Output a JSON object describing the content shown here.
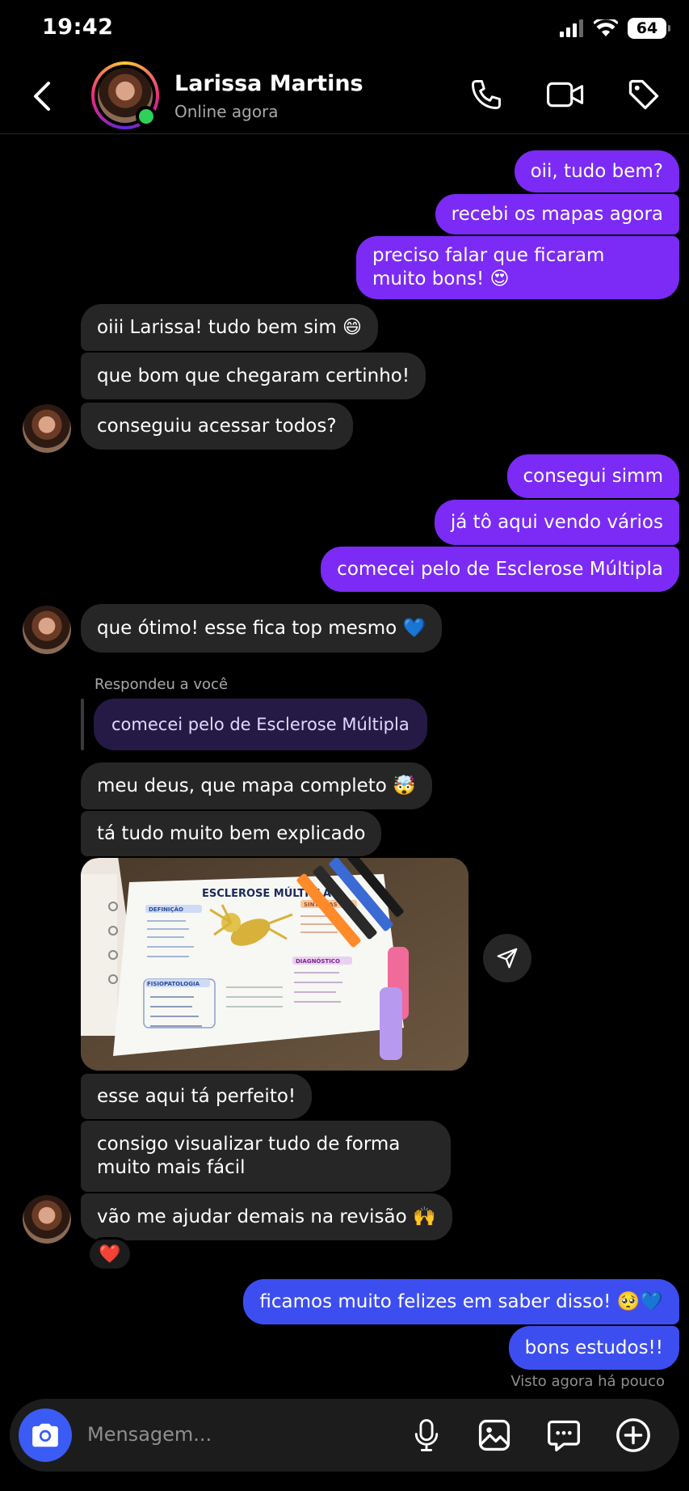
{
  "status_bar": {
    "time": "19:42",
    "battery": "64"
  },
  "header": {
    "contact_name": "Larissa Martins",
    "status": "Online agora",
    "icons": [
      "back-arrow-icon",
      "phone-icon",
      "video-camera-icon",
      "tag-icon"
    ]
  },
  "messages": {
    "m1": "oii, tudo bem?",
    "m2": "recebi os mapas agora",
    "m3a": "preciso falar que ficaram",
    "m3b": "muito bons! 😍",
    "m4": "oiii Larissa! tudo bem sim 😄",
    "m5": "que bom que chegaram certinho!",
    "m6": "conseguiu acessar todos?",
    "m7": "consegui simm",
    "m8": "já tô aqui vendo vários",
    "m9": "comecei pelo de Esclerose Múltipla",
    "m10": "que ótimo! esse fica top mesmo 💙",
    "reply_label": "Respondeu a você",
    "reply_quote": "comecei pelo de Esclerose Múltipla",
    "m11": "meu deus, que mapa completo 🤯",
    "m12": "tá tudo muito bem explicado",
    "photo_title": "ESCLEROSE MÚLTIPLA",
    "photo_labels": {
      "definicao": "DEFINIÇÃO",
      "sintomas": "SINTOMAS",
      "diagnostico": "DIAGNÓSTICO",
      "fisiopatologia": "FISIOPATOLOGIA"
    },
    "m13": "esse aqui tá perfeito!",
    "m14a": "consigo visualizar tudo de forma",
    "m14b": "muito mais fácil",
    "m15": "vão me ajudar demais na revisão 🙌",
    "reaction": "❤️",
    "m16": "ficamos muito felizes em saber disso! 🥺💙",
    "m17": "bons estudos!!",
    "seen": "Visto agora há pouco"
  },
  "composer": {
    "placeholder": "Mensagem...",
    "icons": [
      "camera-icon",
      "microphone-icon",
      "gallery-icon",
      "sticker-chat-icon",
      "plus-icon"
    ]
  },
  "colors": {
    "outgoing": "#7b2bf5",
    "outgoing_blue": "#3d4ef0",
    "incoming": "#262626",
    "online": "#2fd158",
    "camera": "#3b5bf5"
  }
}
